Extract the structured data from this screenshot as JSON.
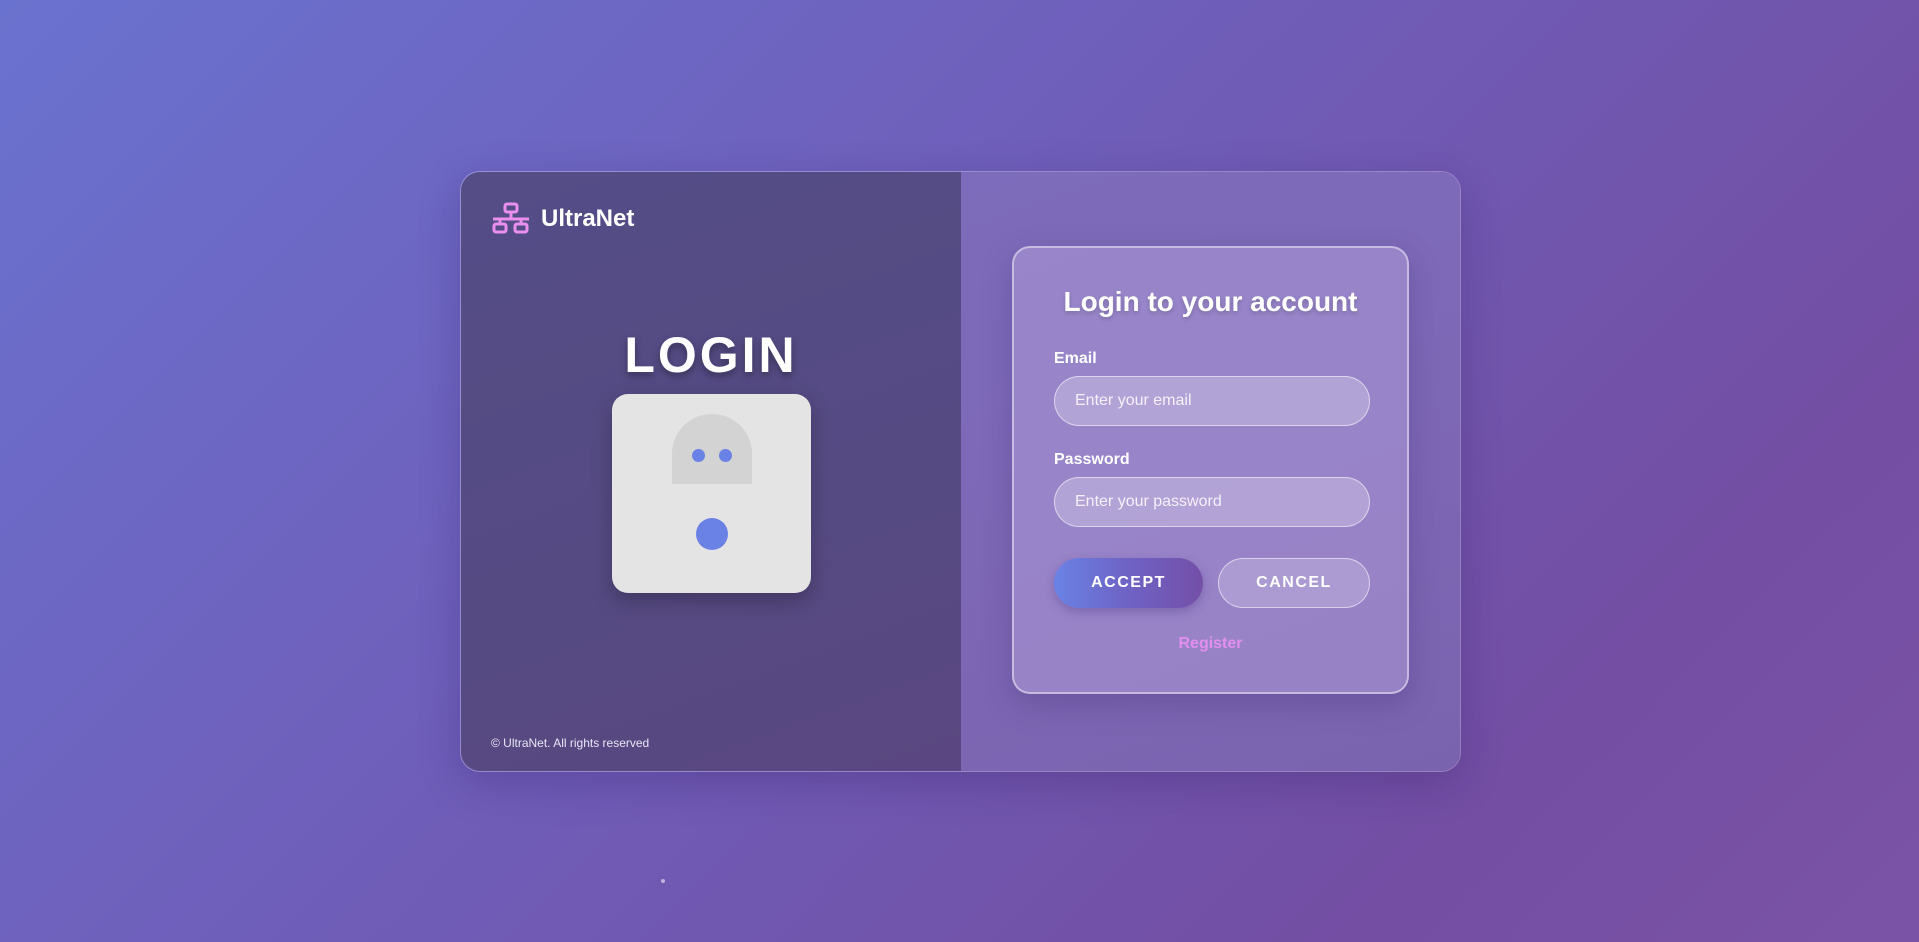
{
  "brand": {
    "name": "UltraNet",
    "icon": "network-icon",
    "icon_color": "#ea8ff0"
  },
  "left_panel": {
    "heading": "LOGIN",
    "illustration": "robot-icon",
    "footer": "© UltraNet. All rights reserved"
  },
  "form": {
    "title": "Login to your account",
    "email": {
      "label": "Email",
      "placeholder": "Enter your email",
      "value": ""
    },
    "password": {
      "label": "Password",
      "placeholder": "Enter your password",
      "value": ""
    },
    "accept_label": "ACCEPT",
    "cancel_label": "CANCEL",
    "register_label": "Register"
  },
  "colors": {
    "accent": "#6a83e5",
    "register_link": "#e38ff0",
    "background_start": "#6a72cf",
    "background_end": "#7b53a6"
  }
}
